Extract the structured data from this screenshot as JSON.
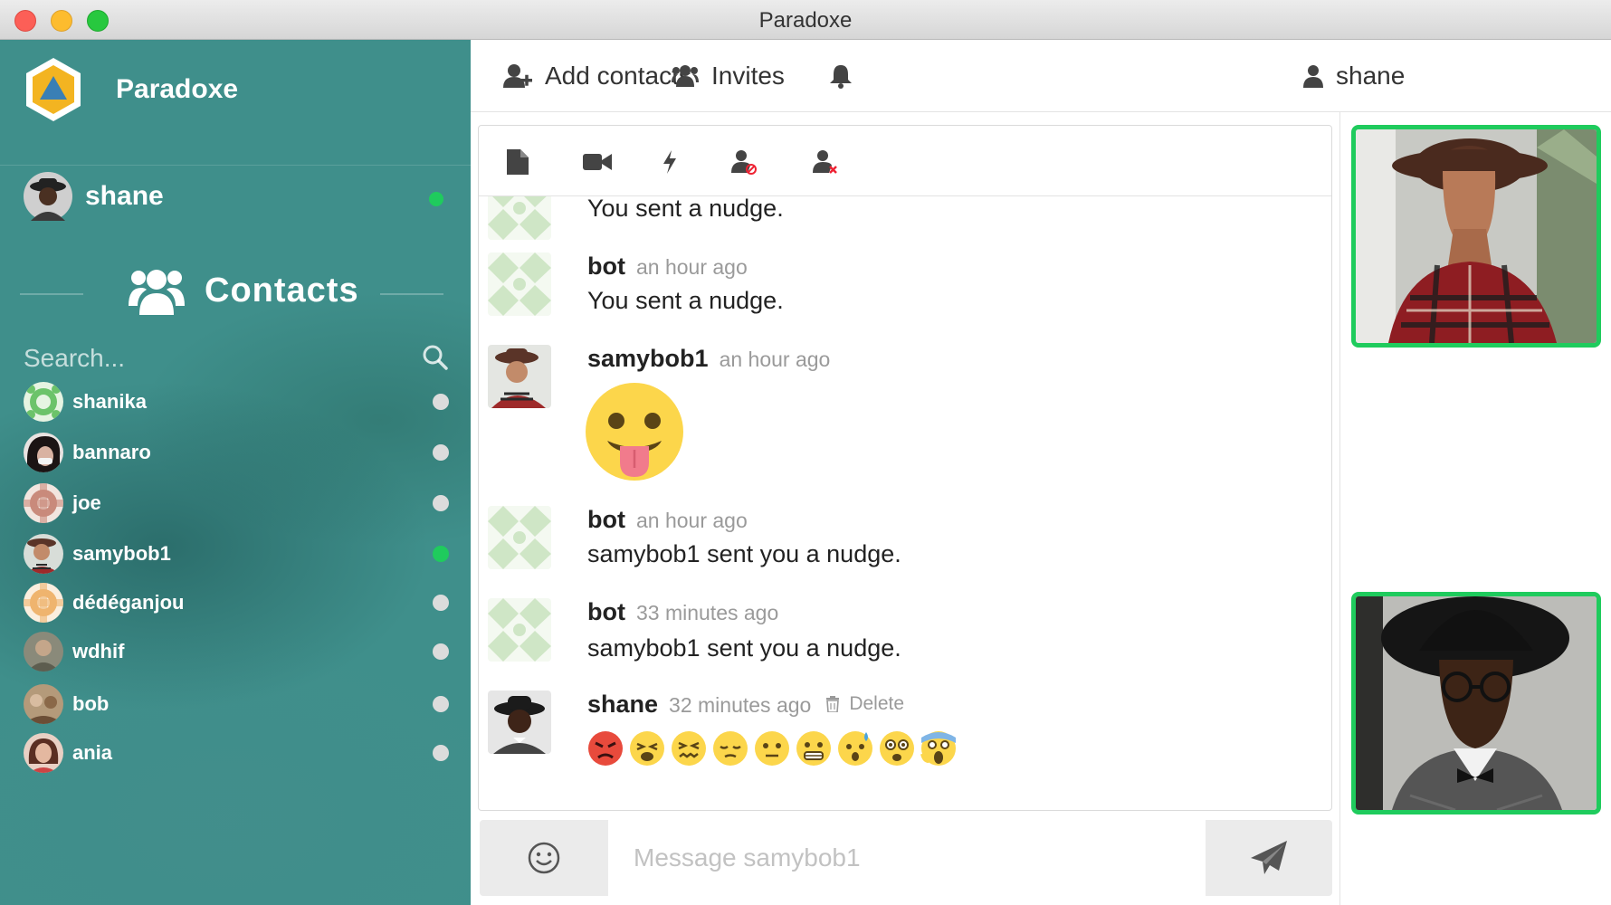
{
  "window": {
    "title": "Paradoxe"
  },
  "sidebar": {
    "brand": "Paradoxe",
    "current_user": {
      "name": "shane",
      "status": "online"
    },
    "contacts_title": "Contacts",
    "search": {
      "placeholder": "Search..."
    },
    "contacts": [
      {
        "name": "shanika",
        "status": "offline"
      },
      {
        "name": "bannaro",
        "status": "offline"
      },
      {
        "name": "joe",
        "status": "offline"
      },
      {
        "name": "samybob1",
        "status": "online"
      },
      {
        "name": "dédéganjou",
        "status": "offline"
      },
      {
        "name": "wdhif",
        "status": "offline"
      },
      {
        "name": "bob",
        "status": "offline"
      },
      {
        "name": "ania",
        "status": "offline"
      }
    ]
  },
  "topbar": {
    "add_contacts": "Add contacts",
    "invites": "Invites",
    "user": "shane"
  },
  "chat_tools": [
    "file-icon",
    "video-camera-icon",
    "nudge-bolt-icon",
    "block-user-icon",
    "remove-user-icon"
  ],
  "messages": [
    {
      "author": "",
      "time": "",
      "text": "You sent a nudge."
    },
    {
      "author": "bot",
      "time": "an hour ago",
      "text": "You sent a nudge."
    },
    {
      "author": "samybob1",
      "time": "an hour ago",
      "emoji": "face-with-tongue"
    },
    {
      "author": "bot",
      "time": "an hour ago",
      "text": "samybob1 sent you a nudge."
    },
    {
      "author": "bot",
      "time": "33 minutes ago",
      "text": "samybob1 sent you a nudge."
    },
    {
      "author": "shane",
      "time": "32 minutes ago",
      "delete_label": "Delete",
      "emojis": [
        "angry",
        "tired",
        "confounded",
        "pensive",
        "neutral",
        "grimacing",
        "anxious-sweat",
        "astonished",
        "screaming"
      ]
    }
  ],
  "composer": {
    "placeholder": "Message samybob1"
  },
  "colors": {
    "sidebar": "#3f8f8b",
    "online": "#1fcb5d",
    "offline": "#dcdcdc",
    "video_border": "#1fcb5d"
  }
}
